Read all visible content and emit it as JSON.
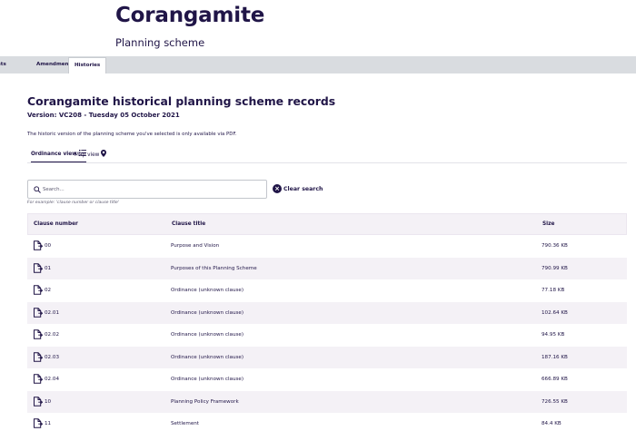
{
  "header": {
    "title": "Corangamite",
    "subtitle": "Planning scheme"
  },
  "tabs": [
    {
      "label": "ents"
    },
    {
      "label": "Amendments"
    },
    {
      "label": "Histories"
    }
  ],
  "records": {
    "heading": "Corangamite historical planning scheme records",
    "version": "Version: VC208 - Tuesday 05 October 2021",
    "note": "The historic version of the planning scheme you've selected is only available via PDF."
  },
  "view_tabs": {
    "ordinance": "Ordinance view",
    "map": "Map view"
  },
  "search": {
    "placeholder": "Search...",
    "value": "",
    "clear_label": "Clear search",
    "hint": "For example: 'clause number or clause title'"
  },
  "table": {
    "columns": [
      "Clause number",
      "Clause title",
      "Size"
    ],
    "rows": [
      {
        "number": "00",
        "title": "Purpose and Vision",
        "size": "790.36 KB"
      },
      {
        "number": "01",
        "title": "Purposes of this Planning Scheme",
        "size": "790.99 KB"
      },
      {
        "number": "02",
        "title": "Ordinance (unknown clause)",
        "size": "77.18 KB"
      },
      {
        "number": "02.01",
        "title": "Ordinance (unknown clause)",
        "size": "102.64 KB"
      },
      {
        "number": "02.02",
        "title": "Ordinance (unknown clause)",
        "size": "94.95 KB"
      },
      {
        "number": "02.03",
        "title": "Ordinance (unknown clause)",
        "size": "187.16 KB"
      },
      {
        "number": "02.04",
        "title": "Ordinance (unknown clause)",
        "size": "666.89 KB"
      },
      {
        "number": "10",
        "title": "Planning Policy Framework",
        "size": "726.55 KB"
      },
      {
        "number": "11",
        "title": "Settlement",
        "size": "84.4 KB"
      }
    ]
  },
  "colors": {
    "brand": "#201547",
    "tabbar": "#d9dce0",
    "row_alt": "#f4f1f6"
  },
  "icons": {
    "document": "document-icon",
    "list": "list-icon",
    "map_pin": "map-pin-icon",
    "search": "search-icon",
    "clear": "close-circle-icon"
  }
}
